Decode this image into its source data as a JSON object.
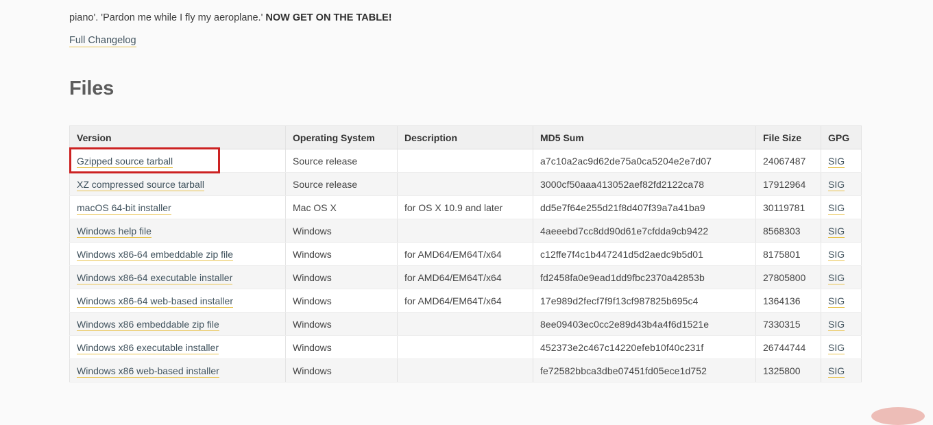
{
  "intro": {
    "text_before_bold": "piano'. 'Pardon me while I fly my aeroplane.' ",
    "bold_text": "NOW GET ON THE TABLE!"
  },
  "changelog_link": "Full Changelog",
  "files_heading": "Files",
  "table": {
    "headers": {
      "version": "Version",
      "operating_system": "Operating System",
      "description": "Description",
      "md5_sum": "MD5 Sum",
      "file_size": "File Size",
      "gpg": "GPG"
    },
    "rows": [
      {
        "version": "Gzipped source tarball",
        "os": "Source release",
        "description": "",
        "md5": "a7c10a2ac9d62de75a0ca5204e2e7d07",
        "size": "24067487",
        "gpg": "SIG"
      },
      {
        "version": "XZ compressed source tarball",
        "os": "Source release",
        "description": "",
        "md5": "3000cf50aaa413052aef82fd2122ca78",
        "size": "17912964",
        "gpg": "SIG"
      },
      {
        "version": "macOS 64-bit installer",
        "os": "Mac OS X",
        "description": "for OS X 10.9 and later",
        "md5": "dd5e7f64e255d21f8d407f39a7a41ba9",
        "size": "30119781",
        "gpg": "SIG"
      },
      {
        "version": "Windows help file",
        "os": "Windows",
        "description": "",
        "md5": "4aeeebd7cc8dd90d61e7cfdda9cb9422",
        "size": "8568303",
        "gpg": "SIG"
      },
      {
        "version": "Windows x86-64 embeddable zip file",
        "os": "Windows",
        "description": "for AMD64/EM64T/x64",
        "md5": "c12ffe7f4c1b447241d5d2aedc9b5d01",
        "size": "8175801",
        "gpg": "SIG"
      },
      {
        "version": "Windows x86-64 executable installer",
        "os": "Windows",
        "description": "for AMD64/EM64T/x64",
        "md5": "fd2458fa0e9ead1dd9fbc2370a42853b",
        "size": "27805800",
        "gpg": "SIG"
      },
      {
        "version": "Windows x86-64 web-based installer",
        "os": "Windows",
        "description": "for AMD64/EM64T/x64",
        "md5": "17e989d2fecf7f9f13cf987825b695c4",
        "size": "1364136",
        "gpg": "SIG"
      },
      {
        "version": "Windows x86 embeddable zip file",
        "os": "Windows",
        "description": "",
        "md5": "8ee09403ec0cc2e89d43b4a4f6d1521e",
        "size": "7330315",
        "gpg": "SIG"
      },
      {
        "version": "Windows x86 executable installer",
        "os": "Windows",
        "description": "",
        "md5": "452373e2c467c14220efeb10f40c231f",
        "size": "26744744",
        "gpg": "SIG"
      },
      {
        "version": "Windows x86 web-based installer",
        "os": "Windows",
        "description": "",
        "md5": "fe72582bbca3dbe07451fd05ece1d752",
        "size": "1325800",
        "gpg": "SIG"
      }
    ]
  },
  "annotation": {
    "highlight_color": "#cc2222",
    "highlight_target": "Gzipped source tarball"
  },
  "colors": {
    "page_background": "#fafafa",
    "link_text": "#41535e",
    "link_underline": "#e8c24a",
    "table_header_background": "#f0f0f0",
    "row_alt_background": "#f5f5f5",
    "heading_text": "#5c5c5c"
  }
}
